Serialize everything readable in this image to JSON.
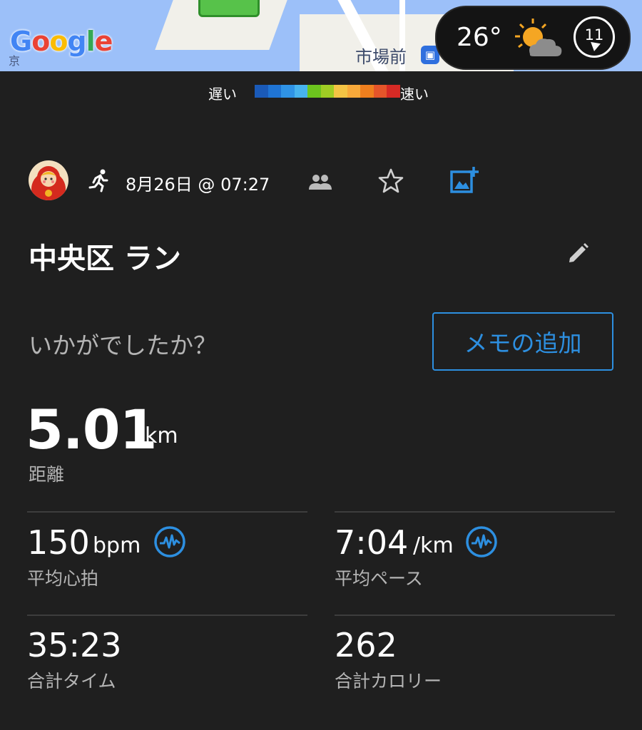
{
  "map": {
    "logo": "Google",
    "station_label": "市場前",
    "train_icon": "train-station-icon",
    "side_label": "京"
  },
  "weather": {
    "temperature": "26°",
    "condition_icon": "partly-cloudy-sun-icon",
    "wind_speed": "11",
    "wind_icon": "wind-direction-icon"
  },
  "legend": {
    "slow_label": "遅い",
    "fast_label": "速い",
    "colors": [
      "#1a5ab8",
      "#1f74d4",
      "#2f93e6",
      "#47b3ee",
      "#6cc41e",
      "#9fcd24",
      "#f3c444",
      "#f7a93a",
      "#ef7f1e",
      "#e5552a",
      "#d62a25"
    ]
  },
  "activity": {
    "avatar": "user-avatar",
    "activity_icon": "running-icon",
    "date": "8月26日 @ 07:27",
    "people_icon": "people-icon",
    "favorite_icon": "star-icon",
    "add_photo_icon": "add-photo-icon",
    "title": "中央区 ラン",
    "edit_icon": "pencil-icon",
    "feedback_prompt": "いかがでしたか？",
    "memo_button_label": "メモの追加"
  },
  "stats": {
    "distance": {
      "value": "5.01",
      "unit": "km",
      "label": "距離"
    },
    "heart_rate": {
      "value": "150",
      "unit": "bpm",
      "label": "平均心拍",
      "icon": "heart-rate-chart-icon"
    },
    "pace": {
      "value": "7:04",
      "unit": "/km",
      "label": "平均ペース",
      "icon": "pace-chart-icon"
    },
    "total_time": {
      "value": "35:23",
      "label": "合計タイム"
    },
    "calories": {
      "value": "262",
      "label": "合計カロリー"
    }
  },
  "colors": {
    "background": "#1f1f1f",
    "accent": "#2d8fe0",
    "secondary_text": "#b4b4b4",
    "divider": "#3d3d3d"
  }
}
